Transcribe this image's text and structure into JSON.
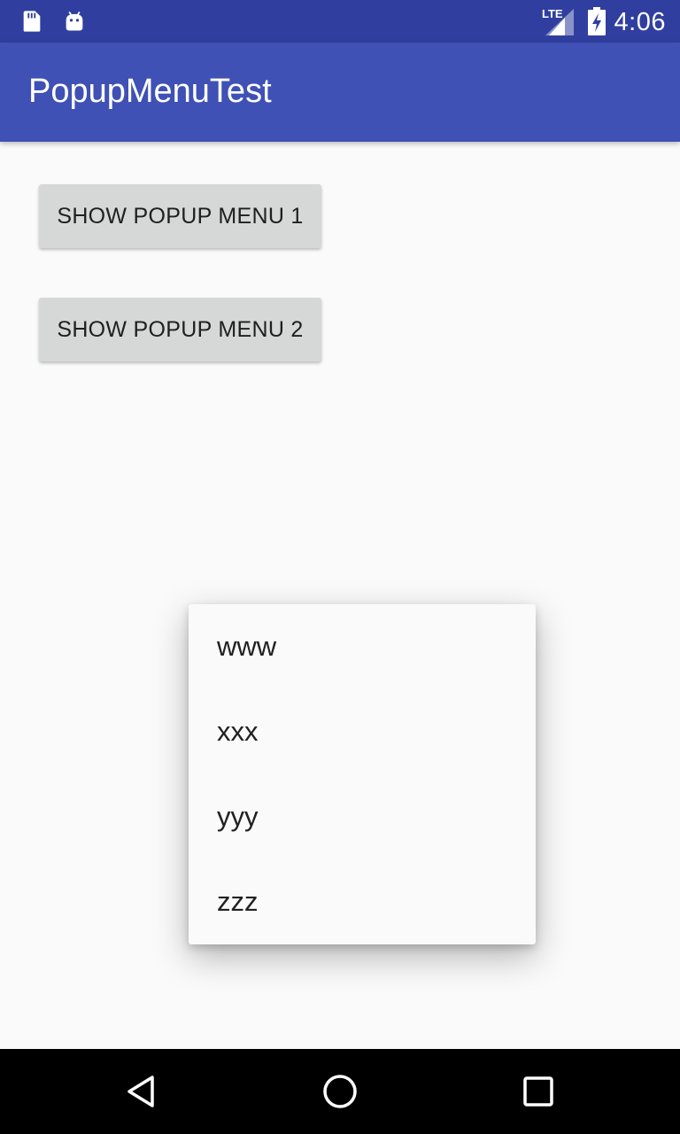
{
  "status_bar": {
    "time": "4:06",
    "network": "LTE",
    "icons": [
      "sd-card-icon",
      "android-debug-icon",
      "lte-signal-icon",
      "battery-charging-icon"
    ]
  },
  "app_bar": {
    "title": "PopupMenuTest"
  },
  "buttons": [
    {
      "label": "SHOW POPUP MENU 1"
    },
    {
      "label": "SHOW POPUP MENU 2"
    }
  ],
  "popup_menu": {
    "items": [
      {
        "label": "www"
      },
      {
        "label": "xxx"
      },
      {
        "label": "yyy"
      },
      {
        "label": "zzz"
      }
    ]
  },
  "nav_bar": {
    "icons": [
      "back-icon",
      "home-icon",
      "recents-icon"
    ]
  },
  "colors": {
    "status_bar": "#303f9f",
    "primary": "#3f51b5",
    "background": "#fafafa",
    "button": "#d6d7d7"
  }
}
